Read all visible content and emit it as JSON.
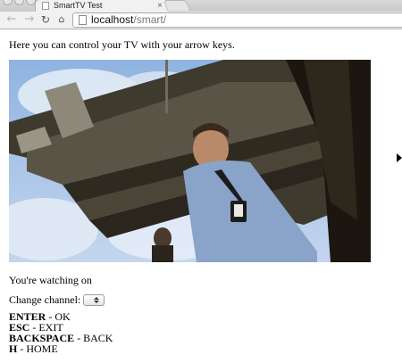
{
  "browser": {
    "tab_title": "SmartTV Test",
    "tab_close": "×",
    "url_host": "localhost",
    "url_path": "/smart/",
    "icons": {
      "back": "arrow-left-icon",
      "forward": "arrow-right-icon",
      "reload": "reload-icon",
      "home": "home-icon"
    }
  },
  "page": {
    "intro": "Here you can control your TV with your arrow keys.",
    "watching": "You're watching on",
    "channel_label": "Change channel:",
    "keys": [
      {
        "key": "ENTER",
        "sep": " - ",
        "action": "OK"
      },
      {
        "key": "ESC",
        "sep": " - ",
        "action": "EXIT"
      },
      {
        "key": "BACKSPACE",
        "sep": " - ",
        "action": "BACK"
      },
      {
        "key": "H",
        "sep": " - ",
        "action": "HOME"
      }
    ]
  }
}
